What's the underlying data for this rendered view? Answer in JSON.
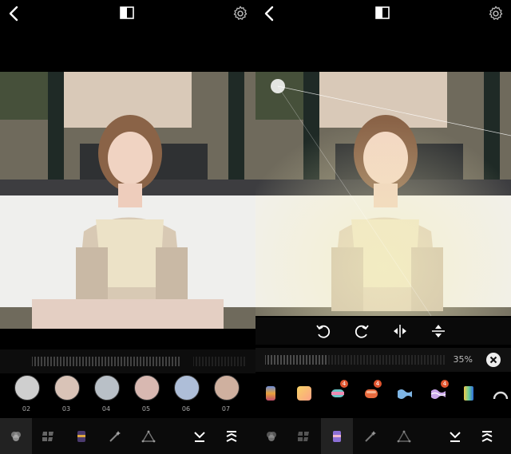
{
  "left": {
    "filters": [
      {
        "label": "02"
      },
      {
        "label": "03"
      },
      {
        "label": "04"
      },
      {
        "label": "05"
      },
      {
        "label": "06"
      },
      {
        "label": "07"
      }
    ],
    "icons": [
      "back-icon",
      "compare-icon",
      "settings-icon"
    ],
    "bottom_nav": [
      "filters-tab-icon",
      "grid-tab-icon",
      "effects-tab-icon",
      "magic-wand-tab-icon",
      "triangle-tab-icon",
      "collapse-icon",
      "expand-icon"
    ]
  },
  "right": {
    "slider": {
      "value_label": "35%"
    },
    "tools": [
      "rotate-left-icon",
      "rotate-right-icon",
      "flip-horizontal-icon",
      "flip-vertical-icon"
    ],
    "palette_badges": [
      "4",
      "4",
      "4"
    ],
    "bottom_nav": [
      "filters-tab-icon",
      "grid-tab-icon",
      "effects-tab-icon",
      "magic-wand-tab-icon",
      "triangle-tab-icon",
      "collapse-icon",
      "expand-icon"
    ],
    "accent": "#e0542e"
  }
}
